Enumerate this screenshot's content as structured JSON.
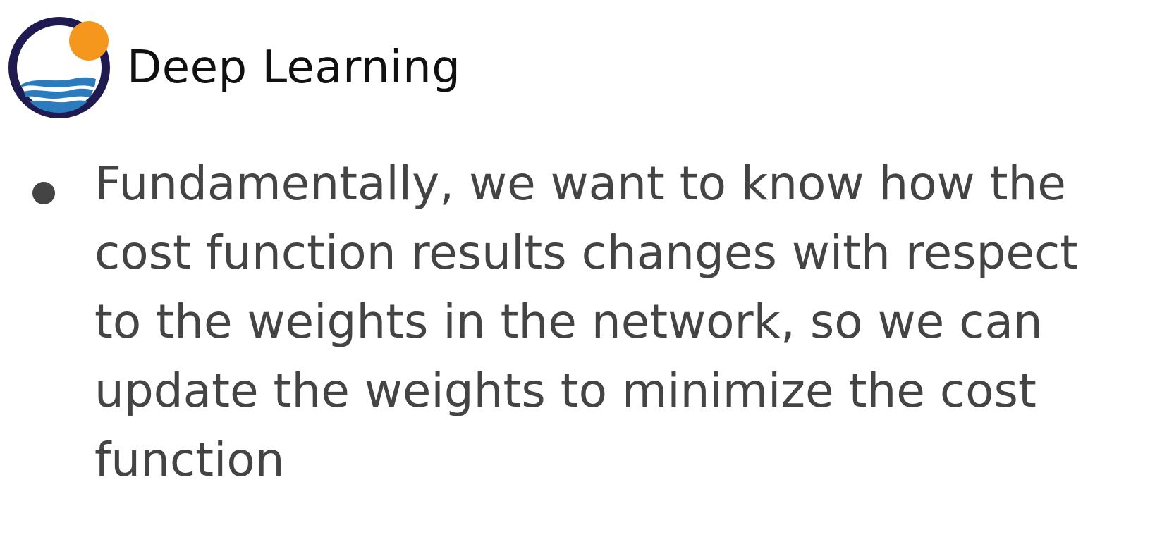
{
  "header": {
    "title": "Deep Learning",
    "logo_icon": "sun-over-waves-logo",
    "colors": {
      "ring": "#1f1a4f",
      "sun": "#f5961d",
      "waves": "#2b7bbd"
    }
  },
  "content": {
    "bullets": [
      {
        "text": "Fundamentally, we want to know how the cost function results changes with respect to the weights in the network, so we can update the weights to minimize the cost function"
      }
    ],
    "colors": {
      "text": "#444444"
    }
  }
}
